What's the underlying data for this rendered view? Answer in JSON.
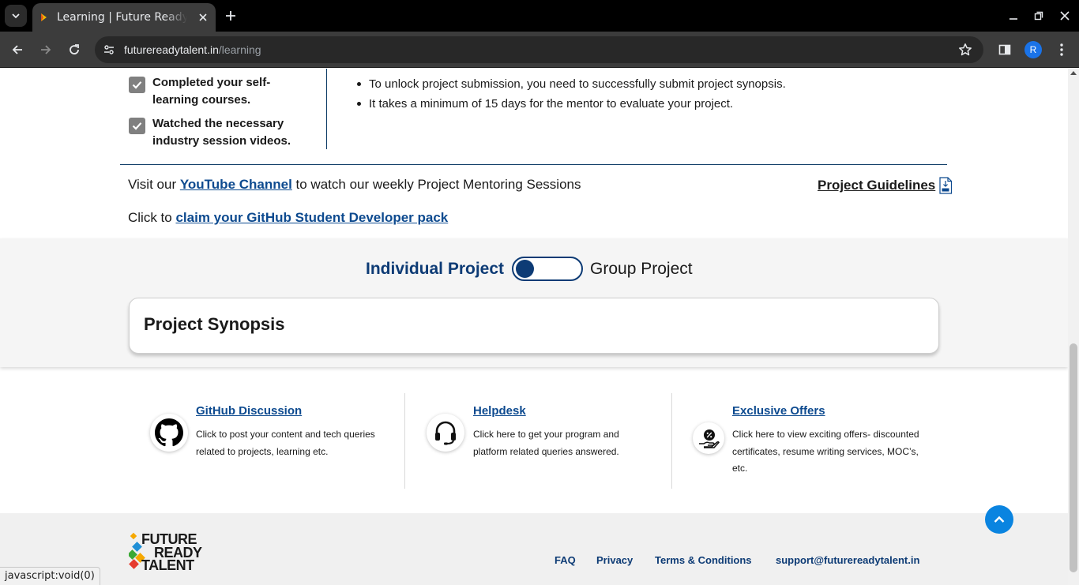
{
  "browser": {
    "tab_title": "Learning | Future Ready Talent",
    "url_domain": "futurereadytalent.in",
    "url_path": "/learning",
    "profile_initial": "R",
    "status_text": "javascript:void(0)"
  },
  "checklist": [
    {
      "label": "Completed your self-learning courses."
    },
    {
      "label": "Watched the necessary industry session videos."
    }
  ],
  "notes": [
    "To unlock project submission, you need to successfully submit project synopsis.",
    "It takes a minimum of 15 days for the mentor to evaluate your project."
  ],
  "visit": {
    "prefix": "Visit our ",
    "link": "YouTube Channel",
    "suffix": " to watch our weekly Project Mentoring Sessions",
    "guidelines": "Project Guidelines"
  },
  "claim": {
    "prefix": "Click to ",
    "link": "claim your GitHub Student Developer pack"
  },
  "project": {
    "individual_label": "Individual Project",
    "group_label": "Group Project",
    "toggle_state": "Individual Project",
    "synopsis_title": "Project Synopsis"
  },
  "help": [
    {
      "title": "GitHub Discussion",
      "desc": "Click to post your content and tech queries related to projects, learning etc.",
      "icon": "github-icon"
    },
    {
      "title": "Helpdesk",
      "desc": "Click here to get your program and platform related queries answered.",
      "icon": "headset-icon"
    },
    {
      "title": "Exclusive Offers",
      "desc": "Click here to view exciting offers- discounted certificates, resume writing services, MOC’s, etc.",
      "icon": "offer-icon"
    }
  ],
  "footer": {
    "logo_lines": [
      "FUTURE",
      "READY",
      "TALENT"
    ],
    "links": [
      "FAQ",
      "Privacy",
      "Terms & Conditions",
      "support@futurereadytalent.in"
    ]
  },
  "colors": {
    "brand_navy": "#0d3b75",
    "link_blue": "#0d4a8f",
    "to_top_blue": "#0a84e0"
  }
}
